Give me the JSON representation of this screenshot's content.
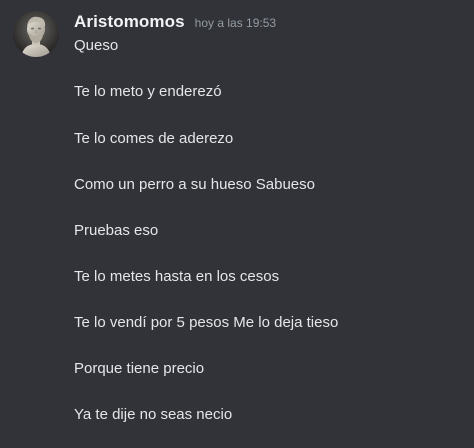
{
  "message": {
    "username": "Aristomomos",
    "timestamp": "hoy a las 19:53",
    "lines": [
      "Queso",
      "Te lo meto y enderezó",
      "Te lo comes de aderezo",
      "Como un perro a su hueso Sabueso",
      "Pruebas eso",
      "Te lo metes hasta en los cesos",
      "Te lo vendí por 5 pesos Me lo deja tieso",
      "Porque tiene precio",
      "Ya te dije no seas necio"
    ]
  },
  "colors": {
    "background": "#313338",
    "username": "#f2f3f5",
    "timestamp": "#949ba4",
    "text": "#e4e6e8"
  },
  "icons": {
    "avatar": "bust-statue-avatar"
  }
}
